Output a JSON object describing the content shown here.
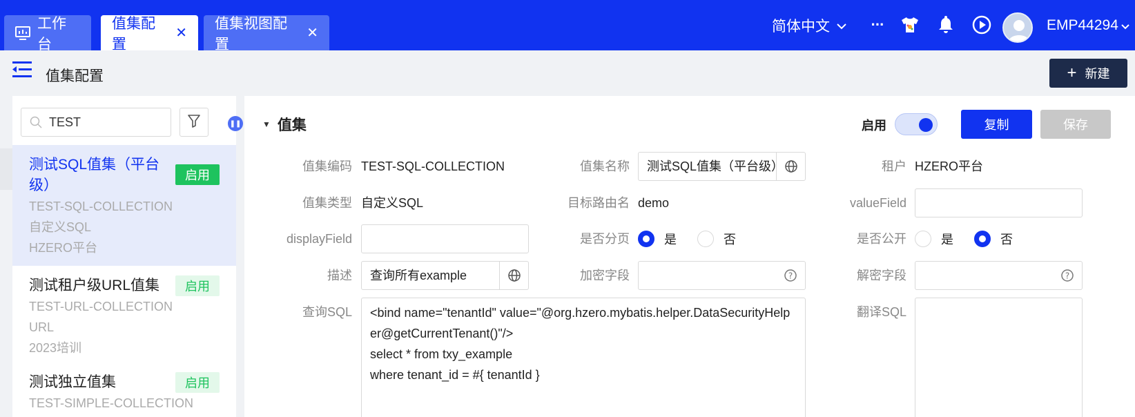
{
  "topbar": {
    "tabs": [
      {
        "label": "工作台"
      },
      {
        "label": "值集配置"
      },
      {
        "label": "值集视图配置"
      }
    ],
    "language": "简体中文",
    "more": "···",
    "user": "EMP44294"
  },
  "header": {
    "title": "值集配置",
    "new_label": "新建"
  },
  "sidebar": {
    "search_value": "TEST",
    "items": [
      {
        "title": "测试SQL值集（平台级）",
        "badge": "启用",
        "lines": [
          "TEST-SQL-COLLECTION",
          "自定义SQL",
          "HZERO平台"
        ]
      },
      {
        "title": "测试租户级URL值集",
        "badge": "启用",
        "lines": [
          "TEST-URL-COLLECTION",
          "URL",
          "2023培训"
        ]
      },
      {
        "title": "测试独立值集",
        "badge": "启用",
        "lines": [
          "TEST-SIMPLE-COLLECTION"
        ]
      }
    ]
  },
  "main": {
    "section_title": "值集",
    "enable_label": "启用",
    "copy_label": "复制",
    "save_label": "保存",
    "fields": {
      "code_label": "值集编码",
      "code_value": "TEST-SQL-COLLECTION",
      "name_label": "值集名称",
      "name_value": "测试SQL值集（平台级）",
      "tenant_label": "租户",
      "tenant_value": "HZERO平台",
      "type_label": "值集类型",
      "type_value": "自定义SQL",
      "route_label": "目标路由名",
      "route_value": "demo",
      "value_field_label": "valueField",
      "value_field_value": "",
      "display_field_label": "displayField",
      "display_field_value": "",
      "paging_label": "是否分页",
      "paging_yes": "是",
      "paging_no": "否",
      "public_label": "是否公开",
      "public_yes": "是",
      "public_no": "否",
      "desc_label": "描述",
      "desc_value": "查询所有example",
      "encrypt_label": "加密字段",
      "encrypt_value": "",
      "decrypt_label": "解密字段",
      "decrypt_value": "",
      "sql_label": "查询SQL",
      "sql_value": "<bind name=\"tenantId\" value=\"@org.hzero.mybatis.helper.DataSecurityHelper@getCurrentTenant()\"/>\nselect * from txy_example\nwhere tenant_id = #{ tenantId }",
      "translate_label": "翻译SQL",
      "translate_value": ""
    }
  },
  "colors": {
    "brand": "#1133f0",
    "success": "#1ec35e",
    "dark_button": "#1d2b4a"
  }
}
